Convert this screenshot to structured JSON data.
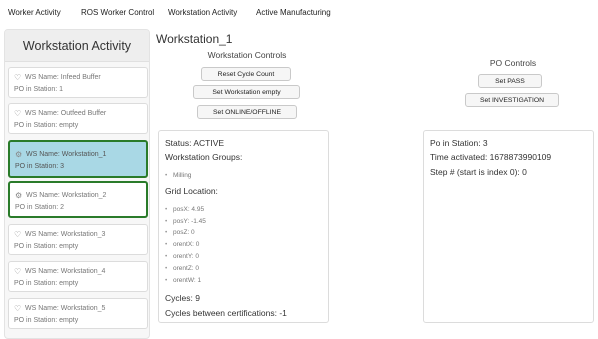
{
  "nav": {
    "items": [
      {
        "label": "Worker Activity"
      },
      {
        "label": "ROS Worker Control"
      },
      {
        "label": "Workstation Activity"
      },
      {
        "label": "Active Manufacturing"
      }
    ]
  },
  "sidebar": {
    "title": "Workstation Activity",
    "items": [
      {
        "name": "WS Name: Infeed Buffer",
        "po": "PO in Station: 1",
        "icon": "heart-icon",
        "state": "normal"
      },
      {
        "name": "WS Name: Outfeed Buffer",
        "po": "PO in Station: empty",
        "icon": "heart-icon",
        "state": "normal"
      },
      {
        "name": "WS Name: Workstation_1",
        "po": "PO in Station: 3",
        "icon": "gears-icon",
        "state": "selected"
      },
      {
        "name": "WS Name: Workstation_2",
        "po": "PO in Station: 2",
        "icon": "gears-icon",
        "state": "outlined"
      },
      {
        "name": "WS Name: Workstation_3",
        "po": "PO in Station: empty",
        "icon": "heart-icon",
        "state": "normal"
      },
      {
        "name": "WS Name: Workstation_4",
        "po": "PO in Station: empty",
        "icon": "heart-icon",
        "state": "normal"
      },
      {
        "name": "WS Name: Workstation_5",
        "po": "PO in Station: empty",
        "icon": "heart-icon",
        "state": "normal"
      }
    ]
  },
  "main": {
    "title": "Workstation_1",
    "workstation_controls": {
      "title": "Workstation Controls",
      "reset_label": "Reset Cycle Count",
      "set_empty_label": "Set Workstation empty",
      "online_label": "Set ONLINE/OFFLINE"
    },
    "po_controls": {
      "title": "PO Controls",
      "pass_label": "Set PASS",
      "investigation_label": "Set INVESTIGATION"
    },
    "status_panel": {
      "status": "Status: ACTIVE",
      "groups_title": "Workstation Groups:",
      "groups": [
        "Milling"
      ],
      "grid_title": "Grid Location:",
      "grid": [
        "posX: 4.95",
        "posY: -1.45",
        "posZ: 0",
        "orentX: 0",
        "orentY: 0",
        "orentZ: 0",
        "orentW: 1"
      ],
      "cycles": "Cycles: 9",
      "cycles_between": "Cycles between certifications: -1"
    },
    "po_panel": {
      "po_in_station": "Po in Station: 3",
      "time_activated": "Time activated: 1678873990109",
      "step": "Step # (start is index 0): 0"
    }
  },
  "colors": {
    "selected_bg": "#a9d8e5",
    "selected_border": "#2a7b2a"
  }
}
